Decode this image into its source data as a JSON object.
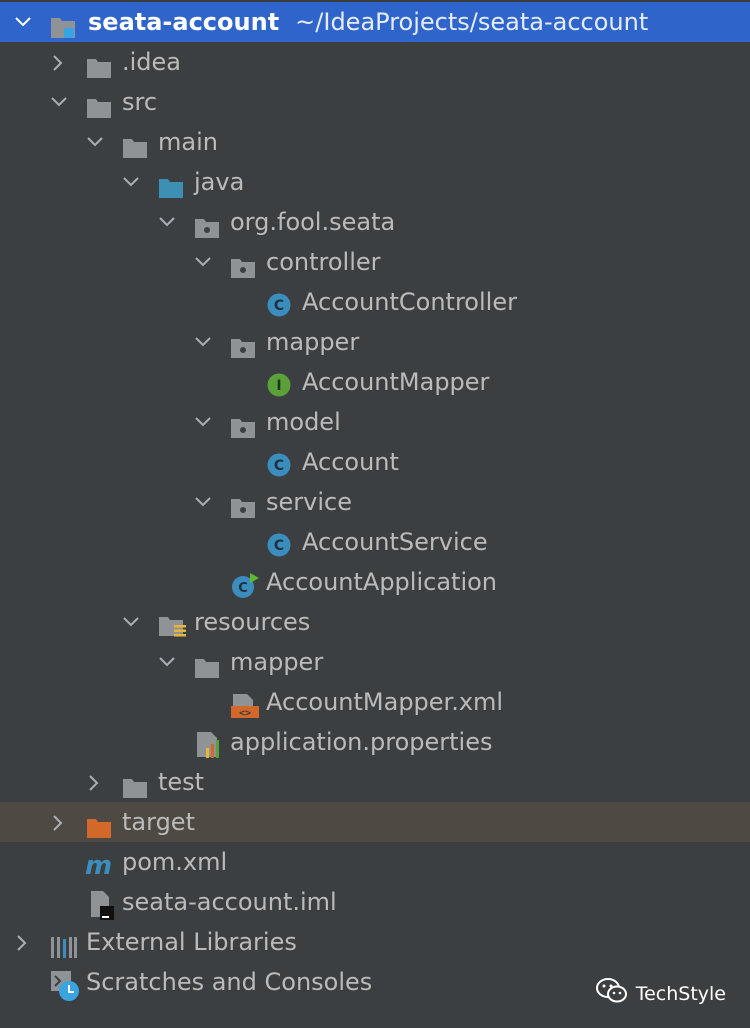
{
  "project": {
    "name": "seata-account",
    "path": "~/IdeaProjects/seata-account"
  },
  "tree": [
    {
      "label": ".idea"
    },
    {
      "label": "src"
    },
    {
      "label": "main"
    },
    {
      "label": "java"
    },
    {
      "label": "org.fool.seata"
    },
    {
      "label": "controller"
    },
    {
      "label": "AccountController"
    },
    {
      "label": "mapper"
    },
    {
      "label": "AccountMapper"
    },
    {
      "label": "model"
    },
    {
      "label": "Account"
    },
    {
      "label": "service"
    },
    {
      "label": "AccountService"
    },
    {
      "label": "AccountApplication"
    },
    {
      "label": "resources"
    },
    {
      "label": "mapper"
    },
    {
      "label": "AccountMapper.xml"
    },
    {
      "label": "application.properties"
    },
    {
      "label": "test"
    },
    {
      "label": "target"
    },
    {
      "label": "pom.xml"
    },
    {
      "label": "seata-account.iml"
    },
    {
      "label": "External Libraries"
    },
    {
      "label": "Scratches and Consoles"
    }
  ],
  "watermark": {
    "text": "TechStyle"
  },
  "colors": {
    "background": "#3c3f41",
    "selection": "#2f65ca",
    "highlight": "#4e4a43",
    "folder": "#8f9396",
    "source_folder": "#3d8fb4",
    "excluded_folder": "#d2692a",
    "class_icon": "#3b8dbd",
    "interface_icon": "#5aa13a"
  }
}
